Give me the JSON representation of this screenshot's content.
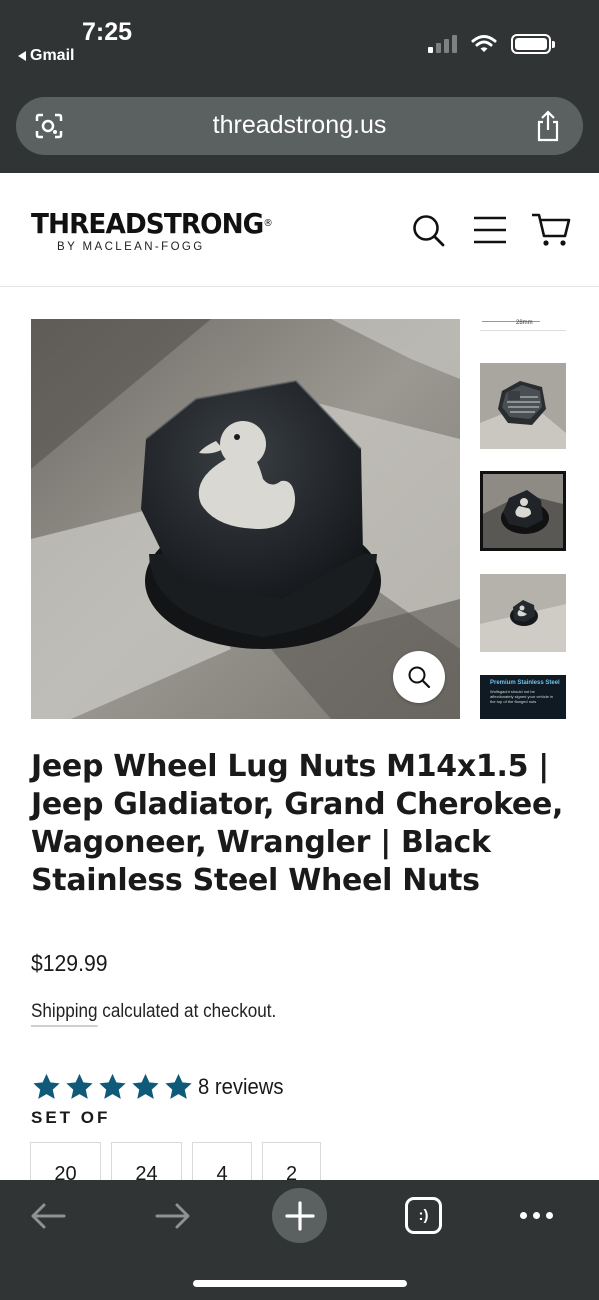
{
  "status_bar": {
    "time": "7:25",
    "back_app": "Gmail",
    "signal_bars_active": 1,
    "battery_level": 1.0
  },
  "browser": {
    "url": "threadstrong.us",
    "icons": {
      "left": "visual-search-icon",
      "right": "share-icon"
    }
  },
  "header": {
    "logo_main": "THREADSTRONG",
    "logo_mark": "®",
    "logo_sub": "BY MACLEAN-FOGG",
    "icons": [
      "search-icon",
      "menu-icon",
      "cart-icon"
    ]
  },
  "gallery": {
    "main_image": "black hex lug nut cap with white duck decal",
    "thumbnails": [
      "dimension drawing",
      "american flag lug nut",
      "duck lug nut",
      "duck lug nut on ground",
      "premium stainless steel"
    ],
    "thumb_1_text": "28mm",
    "thumb_5_title": "Premium Stainless Steel",
    "thumb_5_text": "Wolfsgacht should not be affectionately signed your vehicle in the top of the flanged nuts"
  },
  "product": {
    "title": "Jeep Wheel Lug Nuts M14x1.5 | Jeep Gladiator, Grand Cherokee, Wagoneer, Wrangler | Black Stainless Steel Wheel Nuts",
    "price": "$129.99",
    "shipping_link": "Shipping",
    "shipping_rest": " calculated at checkout.",
    "rating": 5,
    "reviews": "8 reviews",
    "set_label": "SET OF",
    "set_options": [
      "20",
      "24",
      "4",
      "2"
    ]
  },
  "colors": {
    "chrome": "#303435",
    "url_bar": "#5b6061",
    "star": "#0e5a78",
    "text": "#1a1a1a"
  },
  "toolbar": {
    "tabs_label": ":)",
    "icons": [
      "back-arrow-icon",
      "forward-arrow-icon",
      "plus-icon",
      "tabs-icon",
      "more-icon"
    ]
  }
}
